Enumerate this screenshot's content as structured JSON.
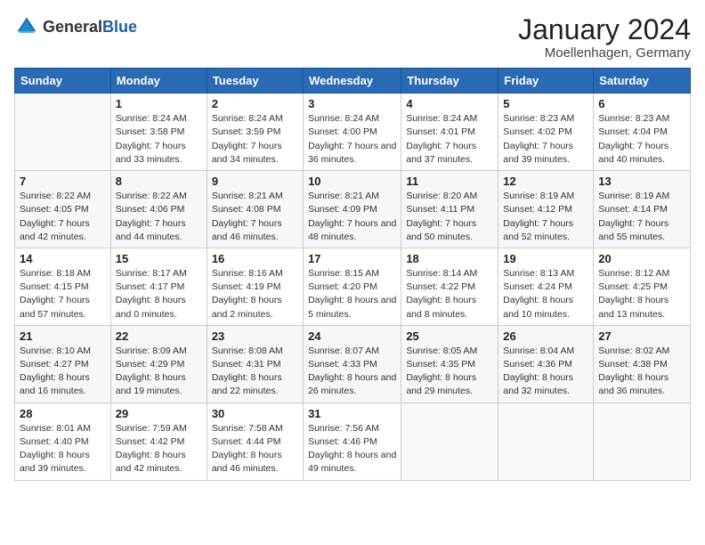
{
  "header": {
    "logo_general": "General",
    "logo_blue": "Blue",
    "month_title": "January 2024",
    "location": "Moellenhagen, Germany"
  },
  "weekdays": [
    "Sunday",
    "Monday",
    "Tuesday",
    "Wednesday",
    "Thursday",
    "Friday",
    "Saturday"
  ],
  "weeks": [
    [
      {
        "day": "",
        "sunrise": "",
        "sunset": "",
        "daylight": ""
      },
      {
        "day": "1",
        "sunrise": "Sunrise: 8:24 AM",
        "sunset": "Sunset: 3:58 PM",
        "daylight": "Daylight: 7 hours and 33 minutes."
      },
      {
        "day": "2",
        "sunrise": "Sunrise: 8:24 AM",
        "sunset": "Sunset: 3:59 PM",
        "daylight": "Daylight: 7 hours and 34 minutes."
      },
      {
        "day": "3",
        "sunrise": "Sunrise: 8:24 AM",
        "sunset": "Sunset: 4:00 PM",
        "daylight": "Daylight: 7 hours and 36 minutes."
      },
      {
        "day": "4",
        "sunrise": "Sunrise: 8:24 AM",
        "sunset": "Sunset: 4:01 PM",
        "daylight": "Daylight: 7 hours and 37 minutes."
      },
      {
        "day": "5",
        "sunrise": "Sunrise: 8:23 AM",
        "sunset": "Sunset: 4:02 PM",
        "daylight": "Daylight: 7 hours and 39 minutes."
      },
      {
        "day": "6",
        "sunrise": "Sunrise: 8:23 AM",
        "sunset": "Sunset: 4:04 PM",
        "daylight": "Daylight: 7 hours and 40 minutes."
      }
    ],
    [
      {
        "day": "7",
        "sunrise": "Sunrise: 8:22 AM",
        "sunset": "Sunset: 4:05 PM",
        "daylight": "Daylight: 7 hours and 42 minutes."
      },
      {
        "day": "8",
        "sunrise": "Sunrise: 8:22 AM",
        "sunset": "Sunset: 4:06 PM",
        "daylight": "Daylight: 7 hours and 44 minutes."
      },
      {
        "day": "9",
        "sunrise": "Sunrise: 8:21 AM",
        "sunset": "Sunset: 4:08 PM",
        "daylight": "Daylight: 7 hours and 46 minutes."
      },
      {
        "day": "10",
        "sunrise": "Sunrise: 8:21 AM",
        "sunset": "Sunset: 4:09 PM",
        "daylight": "Daylight: 7 hours and 48 minutes."
      },
      {
        "day": "11",
        "sunrise": "Sunrise: 8:20 AM",
        "sunset": "Sunset: 4:11 PM",
        "daylight": "Daylight: 7 hours and 50 minutes."
      },
      {
        "day": "12",
        "sunrise": "Sunrise: 8:19 AM",
        "sunset": "Sunset: 4:12 PM",
        "daylight": "Daylight: 7 hours and 52 minutes."
      },
      {
        "day": "13",
        "sunrise": "Sunrise: 8:19 AM",
        "sunset": "Sunset: 4:14 PM",
        "daylight": "Daylight: 7 hours and 55 minutes."
      }
    ],
    [
      {
        "day": "14",
        "sunrise": "Sunrise: 8:18 AM",
        "sunset": "Sunset: 4:15 PM",
        "daylight": "Daylight: 7 hours and 57 minutes."
      },
      {
        "day": "15",
        "sunrise": "Sunrise: 8:17 AM",
        "sunset": "Sunset: 4:17 PM",
        "daylight": "Daylight: 8 hours and 0 minutes."
      },
      {
        "day": "16",
        "sunrise": "Sunrise: 8:16 AM",
        "sunset": "Sunset: 4:19 PM",
        "daylight": "Daylight: 8 hours and 2 minutes."
      },
      {
        "day": "17",
        "sunrise": "Sunrise: 8:15 AM",
        "sunset": "Sunset: 4:20 PM",
        "daylight": "Daylight: 8 hours and 5 minutes."
      },
      {
        "day": "18",
        "sunrise": "Sunrise: 8:14 AM",
        "sunset": "Sunset: 4:22 PM",
        "daylight": "Daylight: 8 hours and 8 minutes."
      },
      {
        "day": "19",
        "sunrise": "Sunrise: 8:13 AM",
        "sunset": "Sunset: 4:24 PM",
        "daylight": "Daylight: 8 hours and 10 minutes."
      },
      {
        "day": "20",
        "sunrise": "Sunrise: 8:12 AM",
        "sunset": "Sunset: 4:25 PM",
        "daylight": "Daylight: 8 hours and 13 minutes."
      }
    ],
    [
      {
        "day": "21",
        "sunrise": "Sunrise: 8:10 AM",
        "sunset": "Sunset: 4:27 PM",
        "daylight": "Daylight: 8 hours and 16 minutes."
      },
      {
        "day": "22",
        "sunrise": "Sunrise: 8:09 AM",
        "sunset": "Sunset: 4:29 PM",
        "daylight": "Daylight: 8 hours and 19 minutes."
      },
      {
        "day": "23",
        "sunrise": "Sunrise: 8:08 AM",
        "sunset": "Sunset: 4:31 PM",
        "daylight": "Daylight: 8 hours and 22 minutes."
      },
      {
        "day": "24",
        "sunrise": "Sunrise: 8:07 AM",
        "sunset": "Sunset: 4:33 PM",
        "daylight": "Daylight: 8 hours and 26 minutes."
      },
      {
        "day": "25",
        "sunrise": "Sunrise: 8:05 AM",
        "sunset": "Sunset: 4:35 PM",
        "daylight": "Daylight: 8 hours and 29 minutes."
      },
      {
        "day": "26",
        "sunrise": "Sunrise: 8:04 AM",
        "sunset": "Sunset: 4:36 PM",
        "daylight": "Daylight: 8 hours and 32 minutes."
      },
      {
        "day": "27",
        "sunrise": "Sunrise: 8:02 AM",
        "sunset": "Sunset: 4:38 PM",
        "daylight": "Daylight: 8 hours and 36 minutes."
      }
    ],
    [
      {
        "day": "28",
        "sunrise": "Sunrise: 8:01 AM",
        "sunset": "Sunset: 4:40 PM",
        "daylight": "Daylight: 8 hours and 39 minutes."
      },
      {
        "day": "29",
        "sunrise": "Sunrise: 7:59 AM",
        "sunset": "Sunset: 4:42 PM",
        "daylight": "Daylight: 8 hours and 42 minutes."
      },
      {
        "day": "30",
        "sunrise": "Sunrise: 7:58 AM",
        "sunset": "Sunset: 4:44 PM",
        "daylight": "Daylight: 8 hours and 46 minutes."
      },
      {
        "day": "31",
        "sunrise": "Sunrise: 7:56 AM",
        "sunset": "Sunset: 4:46 PM",
        "daylight": "Daylight: 8 hours and 49 minutes."
      },
      {
        "day": "",
        "sunrise": "",
        "sunset": "",
        "daylight": ""
      },
      {
        "day": "",
        "sunrise": "",
        "sunset": "",
        "daylight": ""
      },
      {
        "day": "",
        "sunrise": "",
        "sunset": "",
        "daylight": ""
      }
    ]
  ]
}
